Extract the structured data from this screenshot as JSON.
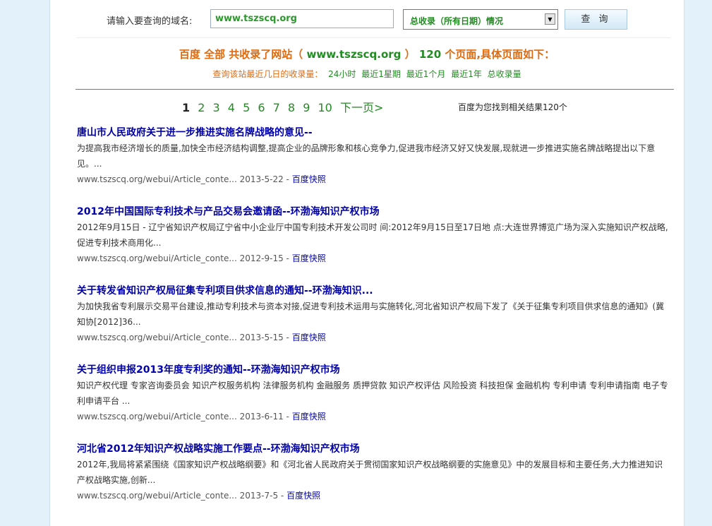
{
  "form": {
    "label": "请输入要查询的域名:",
    "domain_value": "www.tszscq.org",
    "range_selected": "总收录（所有日期）情况",
    "query_button": "查 询"
  },
  "summary": {
    "part1": "百度 全部 共收录了网站（",
    "domain": "www.tszscq.org",
    "part2": "）",
    "count": "120",
    "part3": "个页面,具体页面如下："
  },
  "recent": {
    "label": "查询该站最近几日的收录量：",
    "links": [
      "24小时",
      "最近1星期",
      "最近1个月",
      "最近1年",
      "总收录量"
    ]
  },
  "pager": {
    "current": "1",
    "pages": [
      "2",
      "3",
      "4",
      "5",
      "6",
      "7",
      "8",
      "9",
      "10"
    ],
    "next": "下一页>"
  },
  "result_count": "百度为您找到相关结果120个",
  "results": [
    {
      "title": "唐山市人民政府关于进一步推进实施名牌战略的意见--",
      "snippet": "为提高我市经济增长的质量,加快全市经济结构调整,提高企业的品牌形象和核心竞争力,促进我市经济又好又快发展,现就进一步推进实施名牌战略提出以下意见。...",
      "url": "www.tszscq.org/webui/Article_conte...",
      "date": "2013-5-22",
      "cache": "百度快照"
    },
    {
      "title": "2012年中国国际专利技术与产品交易会邀请函--环渤海知识产权市场",
      "snippet": "2012年9月15日 - 辽宁省知识产权局辽宁省中小企业厅中国专利技术开发公司时 间:2012年9月15日至17日地 点:大连世界博览广场为深入实施知识产权战略,促进专利技术商用化...",
      "url": "www.tszscq.org/webui/Article_conte...",
      "date": "2012-9-15",
      "cache": "百度快照"
    },
    {
      "title": "关于转发省知识产权局征集专利项目供求信息的通知--环渤海知识...",
      "snippet": "为加快我省专利展示交易平台建设,推动专利技术与资本对接,促进专利技术运用与实施转化,河北省知识产权局下发了《关于征集专利项目供求信息的通知》(冀知协[2012]36...",
      "url": "www.tszscq.org/webui/Article_conte...",
      "date": "2013-5-15",
      "cache": "百度快照"
    },
    {
      "title": "关于组织申报2013年度专利奖的通知--环渤海知识产权市场",
      "snippet": "知识产权代理 专家咨询委员会 知识产权服务机构 法律服务机构 金融服务 质押贷款 知识产权评估 风险投资 科技担保 金融机构 专利申请 专利申请指南 电子专利申请平台 ...",
      "url": "www.tszscq.org/webui/Article_conte...",
      "date": "2013-6-11",
      "cache": "百度快照"
    },
    {
      "title": "河北省2012年知识产权战略实施工作要点--环渤海知识产权市场",
      "snippet": "2012年,我局将紧紧围绕《国家知识产权战略纲要》和《河北省人民政府关于贯彻国家知识产权战略纲要的实施意见》中的发展目标和主要任务,大力推进知识产权战略实施,创新...",
      "url": "www.tszscq.org/webui/Article_conte...",
      "date": "2013-7-5",
      "cache": "百度快照"
    }
  ]
}
